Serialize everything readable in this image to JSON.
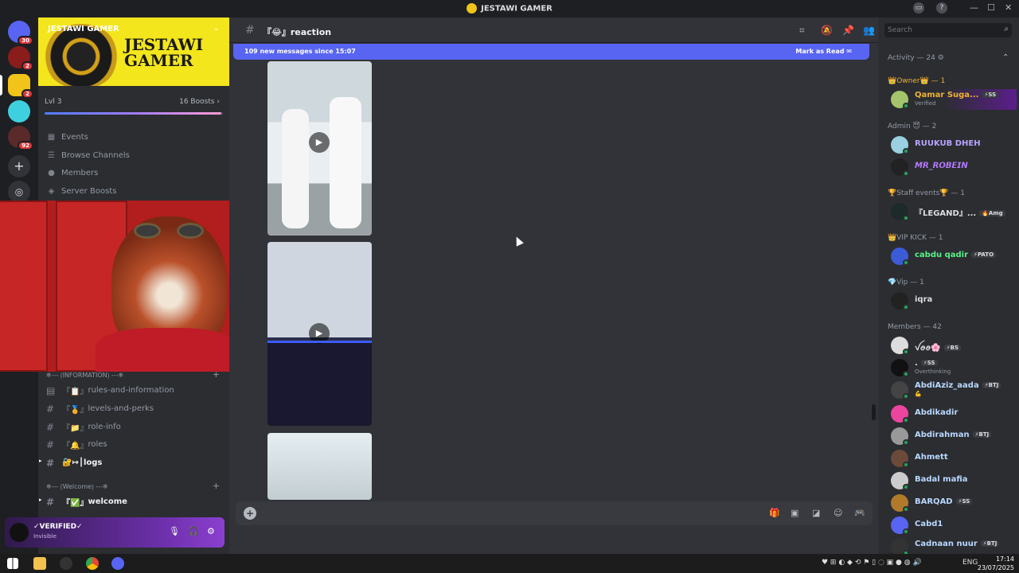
{
  "app": {
    "title": "JESTAWI GAMER"
  },
  "guilds": [
    {
      "badge": "30"
    },
    {
      "badge": "2"
    },
    {
      "badge": "2"
    },
    {
      "badge": ""
    },
    {
      "badge": "92"
    }
  ],
  "server": {
    "name": "JESTAWI GAMER",
    "banner_text": "JESTAWI GAMER",
    "level": "Lvl 3",
    "boosts": "16 Boosts",
    "boost_progress": 0.99
  },
  "nav": [
    {
      "label": "Events",
      "icon": "calendar-icon"
    },
    {
      "label": "Browse Channels",
      "icon": "list-icon"
    },
    {
      "label": "Members",
      "icon": "people-icon"
    },
    {
      "label": "Server Boosts",
      "icon": "boost-icon"
    }
  ],
  "categories": [
    {
      "label": "❄--- ⟮INFORMATION⟯ ---❄"
    },
    {
      "label": "❄--- ⟮Welcome⟯ ---❄"
    }
  ],
  "channels": [
    {
      "name": "rules-and-information",
      "prefix": "『📋』"
    },
    {
      "name": "levels-and-perks",
      "prefix": "『🏅』"
    },
    {
      "name": "role-info",
      "prefix": "『📁』"
    },
    {
      "name": "roles",
      "prefix": "『🔔』"
    },
    {
      "name": "logs",
      "prefix": "🔐↦⎮"
    },
    {
      "name": "welcome",
      "prefix": "『✅』"
    }
  ],
  "user": {
    "name": "✓VERIFIED✓",
    "status": "Invisible"
  },
  "channel": {
    "name": "『😂』reaction"
  },
  "new_messages": {
    "text": "109 new messages since 15:07",
    "action": "Mark as Read"
  },
  "search": {
    "placeholder": "Search"
  },
  "activity": {
    "label": "Activity — 24"
  },
  "roles": [
    {
      "label": "👑Owner👑 — 1"
    },
    {
      "label": "Admin 😇 — 2"
    },
    {
      "label": "🏆Staff events🏆 — 1"
    },
    {
      "label": "👑VIP KICK — 1"
    },
    {
      "label": "💎Vip — 1"
    },
    {
      "label": "Members — 42"
    }
  ],
  "members": [
    {
      "name": "Qamar Suga...",
      "tag": "⚡SS",
      "sub": "Verified",
      "color": "#f0b232"
    },
    {
      "name": "RUUKUB DHEH",
      "tag": "",
      "sub": "",
      "color": "#b9a4ff"
    },
    {
      "name": "𝙈𝙍_𝙍𝙊𝘽𝙀𝙄𝙉",
      "tag": "",
      "sub": "",
      "color": "#b67bff"
    },
    {
      "name": "『LEGAND』...",
      "tag": "🔥Amg",
      "sub": "",
      "color": "#dbdee1"
    },
    {
      "name": "cabdu qadir",
      "tag": "⚡PATO",
      "sub": "",
      "color": "#57f287"
    },
    {
      "name": "iqra",
      "tag": "",
      "sub": "",
      "color": "#dbdee1"
    },
    {
      "name": "ꪜꪮꪮ🌸",
      "tag": "⚡BS",
      "sub": "",
      "color": "#dbdee1"
    },
    {
      "name": ".",
      "tag": "⚡SS",
      "sub": "Overthinking",
      "color": "#dbdee1"
    },
    {
      "name": "AbdiAziz_aada",
      "tag": "⚡BTJ",
      "sub": "💪",
      "color": "#b9d8ff"
    },
    {
      "name": "Abdikadir",
      "tag": "",
      "sub": "",
      "color": "#b9d8ff"
    },
    {
      "name": "Abdirahman",
      "tag": "⚡BTJ",
      "sub": "",
      "color": "#b9d8ff"
    },
    {
      "name": "Ahmett",
      "tag": "",
      "sub": "",
      "color": "#b9d8ff"
    },
    {
      "name": "Badal mafia",
      "tag": "",
      "sub": "",
      "color": "#b9d8ff"
    },
    {
      "name": "BARQAD",
      "tag": "⚡SS",
      "sub": "",
      "color": "#b9d8ff"
    },
    {
      "name": "Cabd1",
      "tag": "",
      "sub": "",
      "color": "#b9d8ff"
    },
    {
      "name": "Cadnaan nuur",
      "tag": "⚡BTJ",
      "sub": "",
      "color": "#b9d8ff"
    }
  ],
  "taskbar": {
    "lang": "ENG",
    "time": "17:14",
    "date": "23/07/2025"
  },
  "colors": {
    "accent": "#5865f2",
    "bg": "#313338",
    "sidebar": "#2b2d31"
  }
}
